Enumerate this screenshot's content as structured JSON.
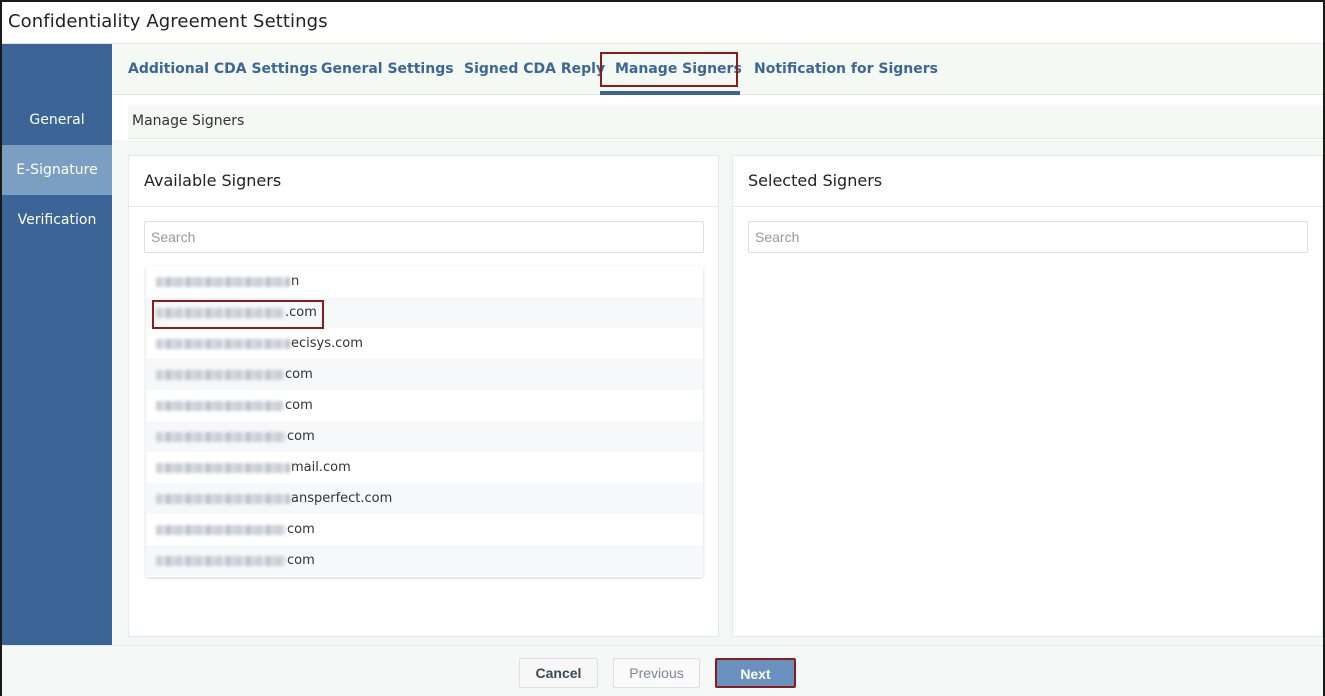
{
  "window": {
    "title": "Confidentiality Agreement Settings"
  },
  "tabs": [
    {
      "label": "Additional CDA Settings",
      "active": false
    },
    {
      "label": "General Settings",
      "active": false
    },
    {
      "label": "Signed CDA Reply",
      "active": false
    },
    {
      "label": "Manage Signers",
      "active": true
    },
    {
      "label": "Notification for Signers",
      "active": false
    }
  ],
  "sidebar": {
    "items": [
      {
        "label": "General",
        "active": false
      },
      {
        "label": "E-Signature",
        "active": true
      },
      {
        "label": "Verification",
        "active": false
      }
    ]
  },
  "section": {
    "title": "Manage Signers"
  },
  "available": {
    "title": "Available Signers",
    "search_placeholder": "Search",
    "items": [
      {
        "suffix": "n"
      },
      {
        "suffix": ".com"
      },
      {
        "suffix": "ecisys.com"
      },
      {
        "suffix": "com"
      },
      {
        "suffix": "com"
      },
      {
        "suffix": "com"
      },
      {
        "suffix": "mail.com"
      },
      {
        "suffix": "ansperfect.com"
      },
      {
        "suffix": "com"
      },
      {
        "suffix": "com"
      }
    ]
  },
  "selected": {
    "title": "Selected Signers",
    "search_placeholder": "Search"
  },
  "footer": {
    "cancel_label": "Cancel",
    "previous_label": "Previous",
    "next_label": "Next"
  },
  "colors": {
    "accent": "#3c6597",
    "sidebar_active": "#7b9fc3",
    "highlight": "#8b1c1c",
    "next_button": "#6a91bd"
  }
}
